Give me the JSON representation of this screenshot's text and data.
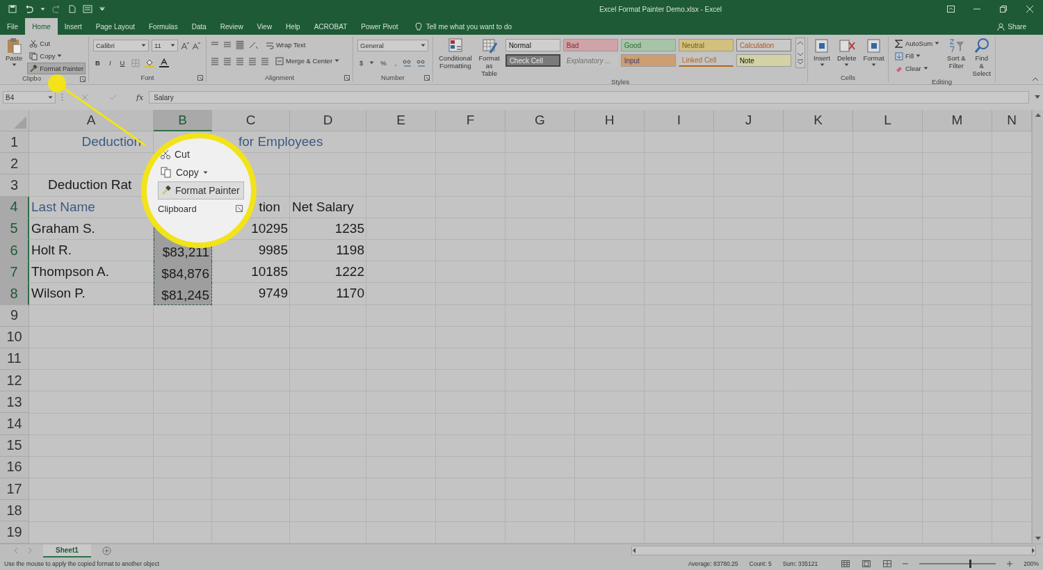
{
  "window": {
    "title": "Excel Format Painter Demo.xlsx  -  Excel"
  },
  "menu_tabs": [
    {
      "label": "File",
      "selected": false
    },
    {
      "label": "Home",
      "selected": true
    },
    {
      "label": "Insert",
      "selected": false
    },
    {
      "label": "Page Layout",
      "selected": false
    },
    {
      "label": "Formulas",
      "selected": false
    },
    {
      "label": "Data",
      "selected": false
    },
    {
      "label": "Review",
      "selected": false
    },
    {
      "label": "View",
      "selected": false
    },
    {
      "label": "Help",
      "selected": false
    },
    {
      "label": "ACROBAT",
      "selected": false
    },
    {
      "label": "Power Pivot",
      "selected": false
    }
  ],
  "tell_me": {
    "placeholder": "Tell me what you want to do"
  },
  "share": "Share",
  "ribbon": {
    "clipboard": {
      "label": "Clipbo",
      "paste": "Paste",
      "cut": "Cut",
      "copy": "Copy",
      "format_painter": {
        "label": "Format Painter",
        "selected": true
      }
    },
    "font": {
      "label": "Font",
      "family": "Calibri",
      "size": "11",
      "bold": "B",
      "italic": "I",
      "underline": "U"
    },
    "alignment": {
      "label": "Alignment",
      "wrap_text": "Wrap Text",
      "merge_center": "Merge & Center"
    },
    "number": {
      "label": "Number",
      "format": "General",
      "currency": "$",
      "percent": "%",
      "comma": ","
    },
    "styles": {
      "label": "Styles",
      "conditional_formatting": "Conditional Formatting",
      "format_as_table": "Format as Table",
      "cell_styles": [
        {
          "label": "Normal",
          "kind": "normal",
          "color": "#cfcfcf"
        },
        {
          "label": "Bad",
          "kind": "bad",
          "color": "#cfa3a8"
        },
        {
          "label": "Good",
          "kind": "good",
          "color": "#a7c4a9"
        },
        {
          "label": "Neutral",
          "kind": "neutral",
          "color": "#d2c07e"
        },
        {
          "label": "Calculation",
          "kind": "calculation",
          "color": "#c9c9c9"
        },
        {
          "label": "Check Cell",
          "kind": "check",
          "color": "#7b7b7b"
        },
        {
          "label": "Explanatory ...",
          "kind": "explanatory",
          "color": "#c4c4c4"
        },
        {
          "label": "Input",
          "kind": "input",
          "color": "#cf9e70"
        },
        {
          "label": "Linked Cell",
          "kind": "linked",
          "color": "#c4c4c4"
        },
        {
          "label": "Note",
          "kind": "note",
          "color": "#d3d2a4"
        }
      ]
    },
    "cells": {
      "label": "Cells",
      "buttons": [
        "Insert",
        "Delete",
        "Format"
      ]
    },
    "editing": {
      "label": "Editing",
      "autosum": "AutoSum",
      "fill": "Fill",
      "clear": "Clear",
      "sort_filter": "Sort & Filter",
      "find_select": "Find & Select"
    }
  },
  "formula_bar": {
    "name_box": "B4",
    "fx": "fx",
    "value": "Salary"
  },
  "sheet": {
    "columns": [
      {
        "label": "A",
        "selected": false
      },
      {
        "label": "B",
        "selected": true
      },
      {
        "label": "C",
        "selected": false
      },
      {
        "label": "D",
        "selected": false
      },
      {
        "label": "E",
        "selected": false
      },
      {
        "label": "F",
        "selected": false
      },
      {
        "label": "G",
        "selected": false
      },
      {
        "label": "H",
        "selected": false
      },
      {
        "label": "I",
        "selected": false
      },
      {
        "label": "J",
        "selected": false
      },
      {
        "label": "K",
        "selected": false
      },
      {
        "label": "L",
        "selected": false
      },
      {
        "label": "M",
        "selected": false
      },
      {
        "label": "N",
        "selected": false
      }
    ],
    "rows": [
      {
        "number": "1",
        "selected": false,
        "cells": [
          {
            "text": "Deduction",
            "kind": "title_end"
          },
          {
            "kind": "blank"
          },
          {
            "text": "for Employees",
            "kind": "title_start"
          }
        ]
      },
      {
        "number": "2",
        "selected": false
      },
      {
        "number": "3",
        "selected": false,
        "cells": [
          {
            "text": "Deduction Rat",
            "kind": "label_indent"
          }
        ]
      },
      {
        "number": "4",
        "selected": true,
        "cells": [
          {
            "text": "Last Name",
            "kind": "heading"
          },
          {
            "kind": "blank"
          },
          {
            "text": "tion",
            "kind": "tail"
          },
          {
            "text": "Net Salary",
            "kind": "text"
          }
        ]
      },
      {
        "number": "5",
        "selected": true,
        "cells": [
          {
            "text": "Graham S.",
            "kind": "text"
          },
          {
            "kind": "copied_top"
          },
          {
            "text": "10295",
            "kind": "number"
          },
          {
            "text": "1235",
            "kind": "number"
          }
        ]
      },
      {
        "number": "6",
        "selected": true,
        "cells": [
          {
            "text": "Holt R.",
            "kind": "text"
          },
          {
            "text": "$83,211",
            "kind": "copied"
          },
          {
            "text": "9985",
            "kind": "number"
          },
          {
            "text": "1198",
            "kind": "number"
          }
        ]
      },
      {
        "number": "7",
        "selected": true,
        "cells": [
          {
            "text": "Thompson A.",
            "kind": "text"
          },
          {
            "text": "$84,876",
            "kind": "copied"
          },
          {
            "text": "10185",
            "kind": "number"
          },
          {
            "text": "1222",
            "kind": "number"
          }
        ]
      },
      {
        "number": "8",
        "selected": true,
        "cells": [
          {
            "text": "Wilson P.",
            "kind": "text"
          },
          {
            "text": "$81,245",
            "kind": "copied_bottom"
          },
          {
            "text": "9749",
            "kind": "number"
          },
          {
            "text": "1170",
            "kind": "number"
          }
        ]
      },
      {
        "number": "9",
        "selected": false
      },
      {
        "number": "10",
        "selected": false
      },
      {
        "number": "11",
        "selected": false
      },
      {
        "number": "12",
        "selected": false
      },
      {
        "number": "13",
        "selected": false
      },
      {
        "number": "14",
        "selected": false
      },
      {
        "number": "15",
        "selected": false
      },
      {
        "number": "16",
        "selected": false
      },
      {
        "number": "17",
        "selected": false
      },
      {
        "number": "18",
        "selected": false
      },
      {
        "number": "19",
        "selected": false
      }
    ]
  },
  "callout": {
    "cut": "Cut",
    "copy": "Copy",
    "format_painter": {
      "label": "Format Painter",
      "selected": true
    },
    "group_label": "Clipboard"
  },
  "sheet_tabs": [
    {
      "label": "Sheet1",
      "selected": true
    }
  ],
  "status_bar": {
    "message": "Use the mouse to apply the copied format to another object",
    "average": "Average: 83780.25",
    "count": "Count: 5",
    "sum": "Sum: 335121",
    "zoom": "200%",
    "zoom_slider": {
      "level": 0.66
    }
  }
}
